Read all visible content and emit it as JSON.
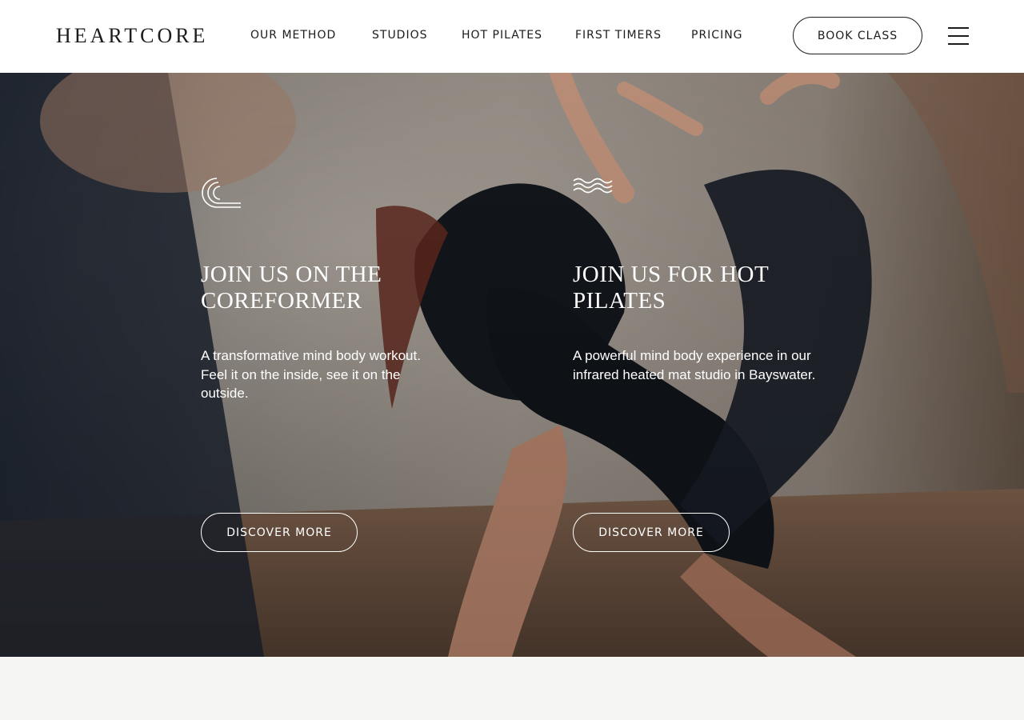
{
  "brand": {
    "name": "HEARTCORE"
  },
  "nav": {
    "items": [
      {
        "label": "OUR METHOD"
      },
      {
        "label": "STUDIOS"
      },
      {
        "label": "HOT PILATES"
      },
      {
        "label": "FIRST TIMERS"
      },
      {
        "label": "PRICING"
      }
    ],
    "book_label": "BOOK CLASS",
    "menu_icon": "hamburger-menu-icon"
  },
  "hero": {
    "columns": [
      {
        "icon": "coreformer-arc-icon",
        "title": "JOIN US ON THE COREFORMER",
        "description": "A transformative mind body workout. Feel it on the inside, see it on the outside.",
        "button_label": "DISCOVER MORE"
      },
      {
        "icon": "heat-waves-icon",
        "title": "JOIN US FOR HOT PILATES",
        "description": "A powerful mind body experience in our infrared heated mat studio in Bayswater.",
        "button_label": "DISCOVER MORE"
      }
    ]
  },
  "colors": {
    "nav_text": "#1c1c1c",
    "hero_text": "#ffffff",
    "page_background": "#f5f5f3"
  }
}
